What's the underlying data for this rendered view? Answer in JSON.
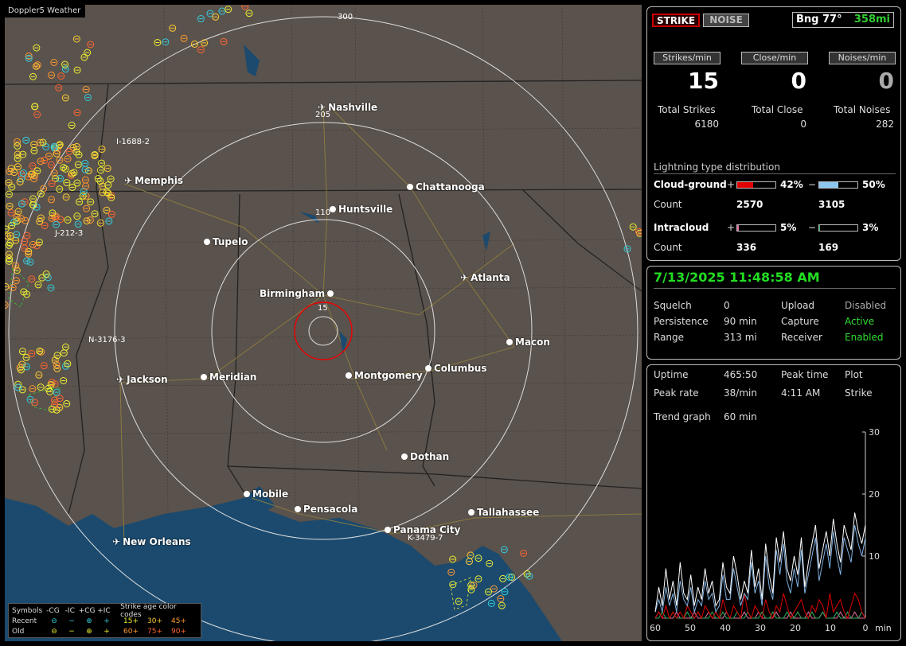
{
  "map": {
    "title": "Doppler5 Weather",
    "rings": [
      "15",
      "110",
      "205",
      "300"
    ],
    "cities": [
      {
        "name": "Nashville",
        "type": "airport"
      },
      {
        "name": "Memphis",
        "type": "airport"
      },
      {
        "name": "Chattanooga",
        "type": "city"
      },
      {
        "name": "Huntsville",
        "type": "city"
      },
      {
        "name": "Tupelo",
        "type": "city"
      },
      {
        "name": "Atlanta",
        "type": "airport"
      },
      {
        "name": "Birmingham",
        "type": "city"
      },
      {
        "name": "Macon",
        "type": "city"
      },
      {
        "name": "Jackson",
        "type": "airport"
      },
      {
        "name": "Meridian",
        "type": "city"
      },
      {
        "name": "Montgomery",
        "type": "city"
      },
      {
        "name": "Columbus",
        "type": "city"
      },
      {
        "name": "Dothan",
        "type": "city"
      },
      {
        "name": "Mobile",
        "type": "city"
      },
      {
        "name": "Pensacola",
        "type": "city"
      },
      {
        "name": "Tallahassee",
        "type": "city"
      },
      {
        "name": "Panama City",
        "type": "city"
      },
      {
        "name": "New Orleans",
        "type": "airport"
      }
    ],
    "storms": [
      "I-1688-2",
      "J-212-3",
      "N-3176-3",
      "K-3479-7"
    ],
    "legend": {
      "row1": {
        "label": "Symbols",
        "cols": [
          "-CG",
          "-IC",
          "+CG",
          "+IC"
        ],
        "age_title": "Strike age color codes"
      },
      "row2": {
        "label": "Recent",
        "syms": [
          "⊖",
          "−",
          "⊕",
          "+"
        ],
        "ages": [
          "15+",
          "30+",
          "45+"
        ]
      },
      "row3": {
        "label": "Old",
        "syms": [
          "⊖",
          "−",
          "⊕",
          "+"
        ],
        "ages": [
          "60+",
          "75+",
          "90+"
        ]
      }
    }
  },
  "panel1": {
    "strike_btn": "STRIKE",
    "noise_btn": "NOISE",
    "bearing": "Bng 77°",
    "range": "358mi",
    "headers": [
      "Strikes/min",
      "Close/min",
      "Noises/min"
    ],
    "rates": [
      "15",
      "0",
      "0"
    ],
    "total_labels": [
      "Total Strikes",
      "Total Close",
      "Total Noises"
    ],
    "totals": [
      "6180",
      "0",
      "282"
    ],
    "dist_title": "Lightning type distribution",
    "cg_label": "Cloud-ground",
    "cg_pos_pct": "42%",
    "cg_neg_pct": "50%",
    "cg_pos_fraction": 0.42,
    "cg_neg_fraction": 0.5,
    "count_label": "Count",
    "cg_pos_count": "2570",
    "cg_neg_count": "3105",
    "ic_label": "Intracloud",
    "ic_pos_pct": "5%",
    "ic_neg_pct": "3%",
    "ic_pos_fraction": 0.05,
    "ic_neg_fraction": 0.03,
    "ic_pos_count": "336",
    "ic_neg_count": "169",
    "plus": "+",
    "minus": "−",
    "colors": {
      "cg_pos": "#e00000",
      "cg_neg": "#8cc8f0",
      "ic_pos": "#e070a0",
      "ic_neg": "#30b060"
    }
  },
  "panel2": {
    "datetime": "7/13/2025 11:48:58 AM",
    "squelch_label": "Squelch",
    "squelch": "0",
    "upload_label": "Upload",
    "upload": "Disabled",
    "persist_label": "Persistence",
    "persist": "90 min",
    "capture_label": "Capture",
    "capture": "Active",
    "range_label": "Range",
    "range": "313 mi",
    "receiver_label": "Receiver",
    "receiver": "Enabled"
  },
  "panel3": {
    "uptime_label": "Uptime",
    "uptime": "465:50",
    "peak_time_label": "Peak time",
    "plot_label": "Plot",
    "peak_rate_label": "Peak rate",
    "peak_rate": "38/min",
    "peak_time": "4:11 AM",
    "plot": "Strike",
    "trend_label": "Trend graph",
    "trend": "60 min"
  },
  "chart_data": {
    "type": "line",
    "x_ticks": [
      "60",
      "50",
      "40",
      "30",
      "20",
      "10",
      "0"
    ],
    "x_unit": "min",
    "y_ticks": [
      "30",
      "20",
      "10"
    ],
    "ylim": [
      0,
      30
    ],
    "xlim": [
      60,
      0
    ],
    "series": [
      {
        "color": "#ffffff",
        "values": [
          1,
          5,
          2,
          8,
          3,
          6,
          2,
          9,
          4,
          3,
          7,
          2,
          5,
          3,
          8,
          4,
          6,
          2,
          3,
          9,
          5,
          4,
          10,
          7,
          3,
          6,
          4,
          11,
          5,
          8,
          3,
          12,
          7,
          4,
          13,
          9,
          14,
          8,
          6,
          10,
          7,
          13,
          5,
          9,
          12,
          15,
          8,
          11,
          14,
          10,
          16,
          12,
          9,
          15,
          13,
          11,
          17,
          14,
          12,
          15
        ]
      },
      {
        "color": "#7fb0e0",
        "values": [
          1,
          3,
          1,
          5,
          2,
          4,
          1,
          6,
          3,
          2,
          5,
          1,
          3,
          2,
          6,
          3,
          4,
          1,
          2,
          7,
          3,
          3,
          8,
          5,
          2,
          4,
          3,
          9,
          4,
          6,
          2,
          10,
          5,
          3,
          11,
          7,
          12,
          6,
          4,
          8,
          5,
          11,
          4,
          7,
          10,
          13,
          6,
          9,
          12,
          8,
          14,
          10,
          7,
          13,
          11,
          9,
          15,
          12,
          10,
          13
        ]
      },
      {
        "color": "#e00000",
        "values": [
          0,
          1,
          0,
          2,
          0,
          1,
          0,
          1,
          0,
          2,
          1,
          0,
          1,
          0,
          2,
          1,
          0,
          1,
          0,
          3,
          1,
          0,
          2,
          1,
          0,
          4,
          1,
          0,
          2,
          1,
          0,
          3,
          1,
          0,
          2,
          1,
          4,
          2,
          0,
          1,
          2,
          3,
          1,
          0,
          2,
          1,
          3,
          2,
          0,
          4,
          1,
          2,
          3,
          1,
          0,
          2,
          4,
          3,
          1,
          0
        ]
      },
      {
        "color": "#30b060",
        "values": [
          0,
          0,
          1,
          0,
          0,
          1,
          0,
          0,
          0,
          1,
          0,
          0,
          1,
          0,
          0,
          0,
          1,
          0,
          0,
          1,
          0,
          0,
          0,
          1,
          0,
          0,
          1,
          0,
          0,
          0,
          1,
          0,
          0,
          1,
          0,
          0,
          0,
          1,
          0,
          0,
          1,
          0,
          0,
          0,
          1,
          0,
          0,
          1,
          0,
          0,
          0,
          1,
          0,
          0,
          1,
          0,
          0,
          0,
          1,
          0
        ]
      },
      {
        "color": "#e070a0",
        "values": [
          0,
          1,
          0,
          0,
          0,
          0,
          1,
          0,
          0,
          0,
          0,
          1,
          0,
          0,
          0,
          1,
          0,
          0,
          0,
          0,
          1,
          0,
          0,
          0,
          0,
          1,
          0,
          0,
          0,
          1,
          0,
          0,
          0,
          0,
          1,
          0,
          0,
          0,
          1,
          0,
          0,
          0,
          0,
          1,
          0,
          0,
          0,
          1,
          0,
          0,
          0,
          0,
          1,
          0,
          0,
          0,
          1,
          0,
          0,
          0
        ]
      }
    ]
  }
}
